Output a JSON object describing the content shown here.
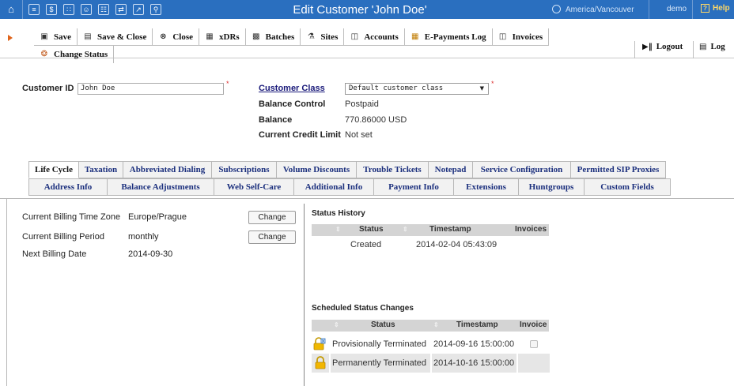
{
  "window": {
    "title": "Edit Customer 'John Doe'",
    "timezone": "America/Vancouver",
    "user": "demo",
    "help": "Help"
  },
  "toolbar": {
    "row1": [
      {
        "icon": "save-icon",
        "label": "Save"
      },
      {
        "icon": "save-close-icon",
        "label": "Save & Close"
      },
      {
        "icon": "close-icon",
        "label": "Close"
      },
      {
        "icon": "xdrs-icon",
        "label": "xDRs"
      },
      {
        "icon": "batches-icon",
        "label": "Batches"
      },
      {
        "icon": "sites-icon",
        "label": "Sites"
      },
      {
        "icon": "accounts-icon",
        "label": "Accounts"
      },
      {
        "icon": "e-payments-log-icon",
        "label": "E-Payments Log"
      },
      {
        "icon": "invoices-icon",
        "label": "Invoices"
      }
    ],
    "row2": [
      {
        "icon": "change-status-icon",
        "label": "Change Status"
      }
    ],
    "logout": "Logout",
    "log": "Log"
  },
  "customer": {
    "id_label": "Customer ID",
    "id_value": "John Doe",
    "class_label": "Customer Class",
    "class_value": "Default customer class",
    "balance_control_label": "Balance Control",
    "balance_control_value": "Postpaid",
    "balance_label": "Balance",
    "balance_value": "770.86000 USD",
    "credit_limit_label": "Current Credit Limit",
    "credit_limit_value": "Not set"
  },
  "tabs": {
    "row1": [
      "Life Cycle",
      "Taxation",
      "Abbreviated Dialing",
      "Subscriptions",
      "Volume Discounts",
      "Trouble Tickets",
      "Notepad",
      "Service Configuration",
      "Permitted SIP Proxies"
    ],
    "row2": [
      "Address Info",
      "Balance Adjustments",
      "Web Self-Care",
      "Additional Info",
      "Payment Info",
      "Extensions",
      "Huntgroups",
      "Custom Fields"
    ],
    "active": "Life Cycle"
  },
  "billing": {
    "timezone_label": "Current Billing Time Zone",
    "timezone_value": "Europe/Prague",
    "period_label": "Current Billing Period",
    "period_value": "monthly",
    "next_date_label": "Next Billing Date",
    "next_date_value": "2014-09-30",
    "change_label": "Change"
  },
  "status_history": {
    "title": "Status History",
    "columns": [
      "Status",
      "Timestamp",
      "Invoices"
    ],
    "rows": [
      {
        "status": "Created",
        "timestamp": "2014-02-04 05:43:09"
      }
    ]
  },
  "scheduled": {
    "title": "Scheduled Status Changes",
    "columns": [
      "Status",
      "Timestamp",
      "Invoice"
    ],
    "rows": [
      {
        "icon": "lock-clock-icon",
        "status": "Provisionally Terminated",
        "timestamp": "2014-09-16 15:00:00",
        "invoice_checked": false
      },
      {
        "icon": "lock-icon",
        "status": "Permanently Terminated",
        "timestamp": "2014-10-16 15:00:00"
      }
    ]
  },
  "colors": {
    "topbar": "#2a6fbf",
    "tab_text": "#1b2f7d",
    "table_header": "#d4d4d4"
  }
}
